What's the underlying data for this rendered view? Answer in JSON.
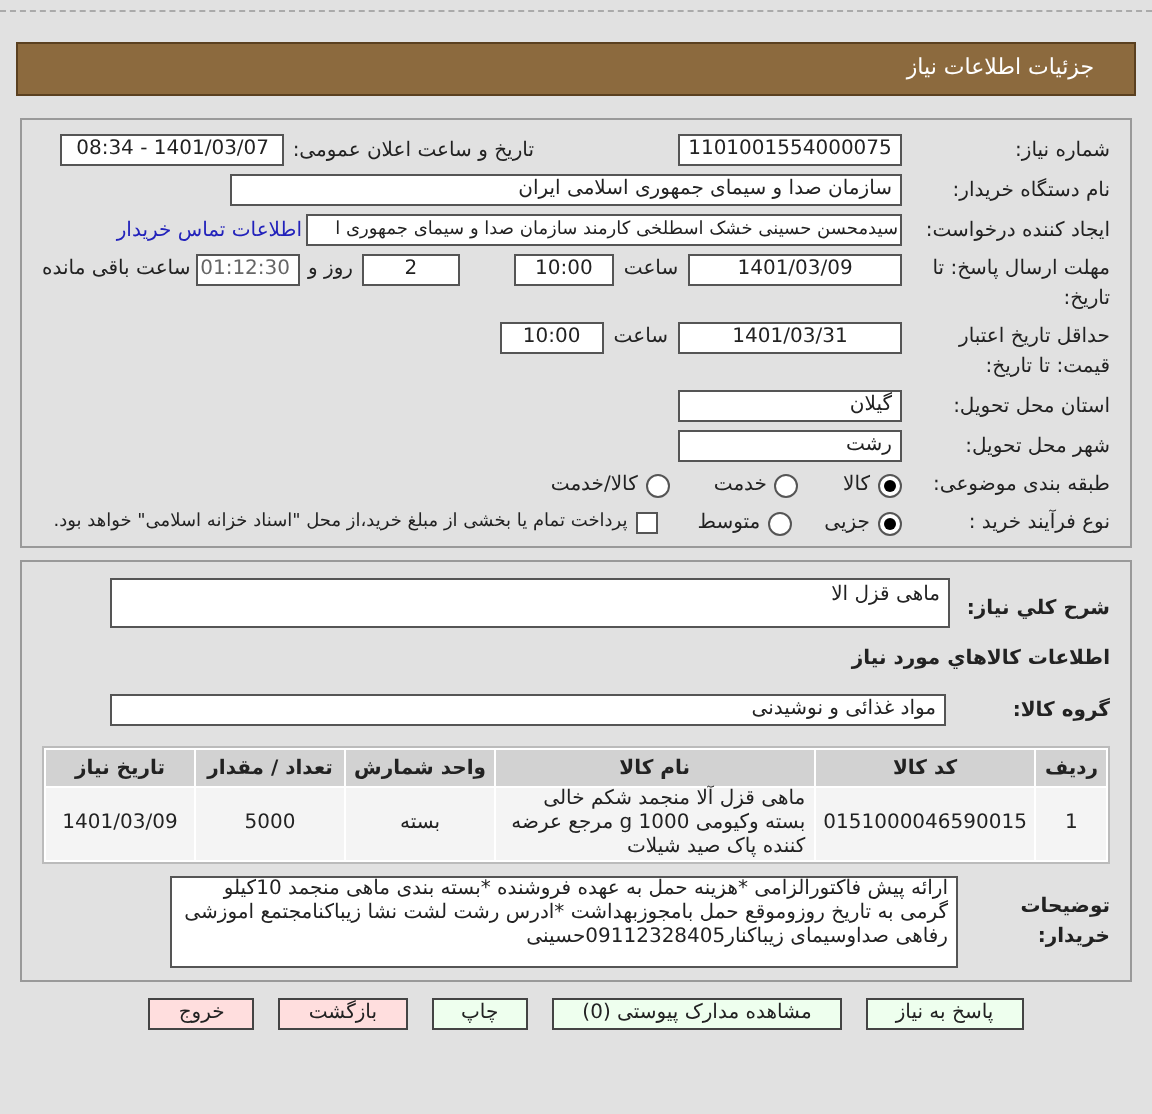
{
  "header": {
    "title": "جزئیات اطلاعات نیاز"
  },
  "need_number": {
    "label": "شماره نیاز:",
    "value": "1101001554000075"
  },
  "announce": {
    "label": "تاریخ و ساعت اعلان عمومی:",
    "value": "1401/03/07 - 08:34"
  },
  "buyer_org": {
    "label": "نام دستگاه خریدار:",
    "value": "سازمان صدا و سیمای جمهوری اسلامی ایران"
  },
  "requester": {
    "label": "ایجاد کننده درخواست:",
    "value": "سیدمحسن حسینی خشک اسطلخی کارمند سازمان صدا و سیمای جمهوری ا",
    "link": "اطلاعات تماس خریدار"
  },
  "deadline": {
    "label": "مهلت ارسال پاسخ: تا تاریخ:",
    "date": "1401/03/09",
    "time_label": "ساعت",
    "time": "10:00",
    "days": "2",
    "days_label": "روز و",
    "remaining": "01:12:30",
    "remaining_label": "ساعت باقی مانده"
  },
  "validity": {
    "label": "حداقل تاریخ اعتبار قیمت: تا تاریخ:",
    "date": "1401/03/31",
    "time_label": "ساعت",
    "time": "10:00"
  },
  "province": {
    "label": "استان محل تحویل:",
    "value": "گیلان"
  },
  "city": {
    "label": "شهر محل تحویل:",
    "value": "رشت"
  },
  "category": {
    "label": "طبقه بندی موضوعی:",
    "options": [
      {
        "label": "کالا",
        "selected": true
      },
      {
        "label": "خدمت",
        "selected": false
      },
      {
        "label": "کالا/خدمت",
        "selected": false
      }
    ]
  },
  "process": {
    "label": "نوع فرآیند خرید :",
    "options": [
      {
        "label": "جزیی",
        "selected": true
      },
      {
        "label": "متوسط",
        "selected": false
      }
    ],
    "treasury": {
      "checked": false,
      "label": "پرداخت تمام یا بخشی از مبلغ خرید،از محل \"اسناد خزانه اسلامی\" خواهد بود."
    }
  },
  "description": {
    "label": "شرح کلي نياز:",
    "value": "ماهی قزل الا"
  },
  "goods_heading": "اطلاعات کالاهاي مورد نياز",
  "goods_group": {
    "label": "گروه کالا:",
    "value": "مواد غذائی و نوشیدنی"
  },
  "table": {
    "columns": [
      "ردیف",
      "کد کالا",
      "نام کالا",
      "واحد شمارش",
      "تعداد / مقدار",
      "تاریخ نیاز"
    ],
    "rows": [
      [
        "1",
        "0151000046590015",
        "ماهی قزل آلا منجمد شکم خالی بسته وکیومی 1000 g مرجع عرضه کننده پاک صید شیلات",
        "بسته",
        "5000",
        "1401/03/09"
      ]
    ]
  },
  "buyer_notes": {
    "label": "توضیحات خریدار:",
    "value": "ارائه پیش فاکتورالزامی *هزینه حمل به عهده فروشنده *بسته بندی ماهی منجمد 10کیلو گرمی به تاریخ روزوموقع حمل بامجوزبهداشت *ادرس رشت لشت نشا زیباکنامجتمع اموزشی رفاهی صداوسیمای زیباکنار09112328405حسینی"
  },
  "buttons": [
    {
      "label": "پاسخ به نیاز",
      "kind": "green"
    },
    {
      "label": "مشاهده مدارک پیوستی (0)",
      "kind": "green"
    },
    {
      "label": "چاپ",
      "kind": "green"
    },
    {
      "label": "بازگشت",
      "kind": "red"
    },
    {
      "label": "خروج",
      "kind": "red"
    }
  ]
}
